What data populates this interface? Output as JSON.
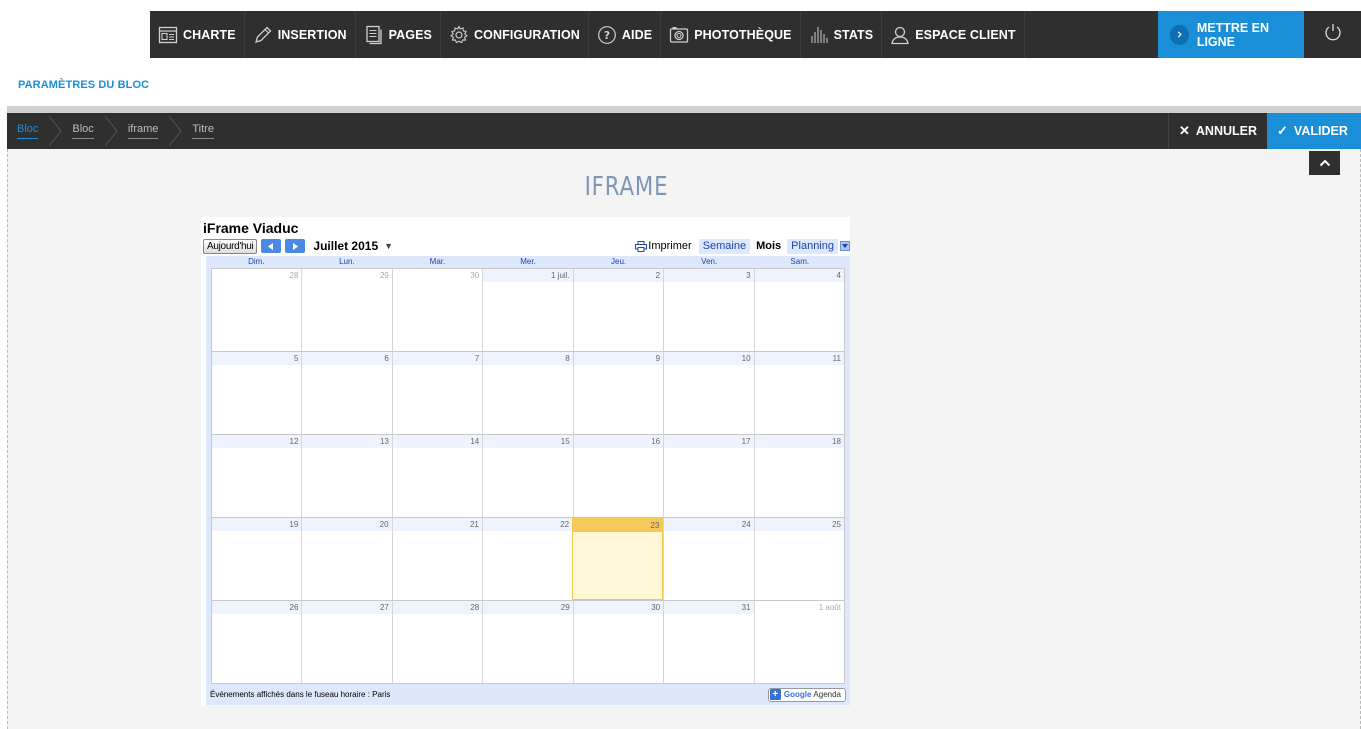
{
  "toolbar": {
    "items": [
      {
        "label": "CHARTE",
        "icon": "layout-icon"
      },
      {
        "label": "INSERTION",
        "icon": "pencil-icon"
      },
      {
        "label": "PAGES",
        "icon": "document-icon"
      },
      {
        "label": "CONFIGURATION",
        "icon": "gear-icon"
      },
      {
        "label": "AIDE",
        "icon": "help-icon"
      },
      {
        "label": "PHOTOTHÈQUE",
        "icon": "camera-icon"
      },
      {
        "label": "STATS",
        "icon": "stats-bars-icon"
      },
      {
        "label": "ESPACE CLIENT",
        "icon": "user-icon"
      }
    ],
    "publish_label": "METTRE EN LIGNE",
    "publish_color": "#1a8fd8"
  },
  "section_title": "PARAMÈTRES DU BLOC",
  "breadcrumb": [
    "Bloc",
    "Bloc",
    "iframe",
    "Titre"
  ],
  "actions": {
    "cancel": "ANNULER",
    "validate": "VALIDER"
  },
  "block_title": "IFRAME",
  "calendar": {
    "title": "iFrame Viaduc",
    "today_label": "Aujourd'hui",
    "month_label": "Juillet 2015",
    "print_label": "Imprimer",
    "views": [
      "Semaine",
      "Mois",
      "Planning"
    ],
    "selected_view": "Mois",
    "weekdays": [
      "Dim.",
      "Lun.",
      "Mar.",
      "Mer.",
      "Jeu.",
      "Ven.",
      "Sam."
    ],
    "weeks": [
      [
        "28",
        "29",
        "30",
        "1 juil.",
        "2",
        "3",
        "4"
      ],
      [
        "5",
        "6",
        "7",
        "8",
        "9",
        "10",
        "11"
      ],
      [
        "12",
        "13",
        "14",
        "15",
        "16",
        "17",
        "18"
      ],
      [
        "19",
        "20",
        "21",
        "22",
        "23",
        "24",
        "25"
      ],
      [
        "26",
        "27",
        "28",
        "29",
        "30",
        "31",
        "1 août"
      ]
    ],
    "today_day": "23",
    "timezone_note": "Événements affichés dans le fuseau horaire : Paris",
    "badge_google": "Google",
    "badge_agenda": "Agenda"
  }
}
